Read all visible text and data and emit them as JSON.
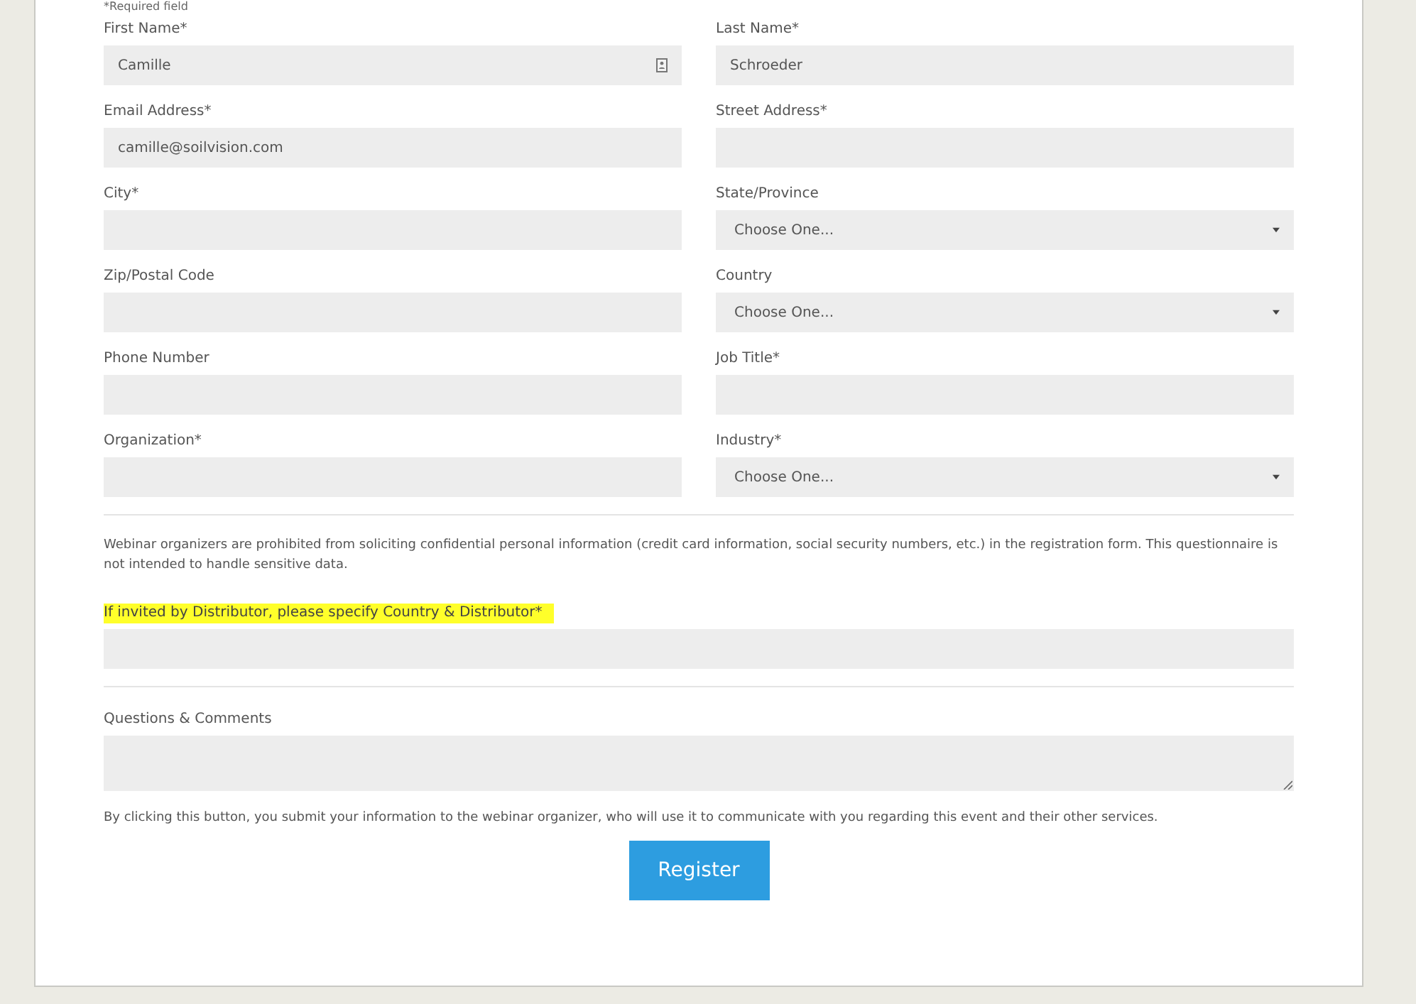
{
  "required_note": "*Required field",
  "fields": [
    {
      "label": "First Name*",
      "kind": "text",
      "value": "Camille",
      "autofill_icon": true
    },
    {
      "label": "Last Name*",
      "kind": "text",
      "value": "Schroeder"
    },
    {
      "label": "Email Address*",
      "kind": "text",
      "value": "camille@soilvision.com"
    },
    {
      "label": "Street Address*",
      "kind": "text"
    },
    {
      "label": "City*",
      "kind": "text"
    },
    {
      "label": "State/Province",
      "kind": "select",
      "value": "Choose One..."
    },
    {
      "label": "Zip/Postal Code",
      "kind": "text"
    },
    {
      "label": "Country",
      "kind": "select",
      "value": "Choose One..."
    },
    {
      "label": "Phone Number",
      "kind": "text"
    },
    {
      "label": "Job Title*",
      "kind": "text"
    },
    {
      "label": "Organization*",
      "kind": "text"
    },
    {
      "label": "Industry*",
      "kind": "select",
      "value": "Choose One..."
    }
  ],
  "privacy_notice": "Webinar organizers are prohibited from soliciting confidential personal information (credit card information, social security numbers, etc.) in the registration form. This questionnaire is not intended to handle sensitive data.",
  "distributor_field": {
    "label": "If invited by Distributor, please specify Country & Distributor*",
    "highlighted": true
  },
  "comments_field": {
    "label": "Questions & Comments"
  },
  "consent_text": "By clicking this button, you submit your information to the webinar organizer, who will use it to communicate with you regarding this event and their other services.",
  "submit_button": "Register"
}
